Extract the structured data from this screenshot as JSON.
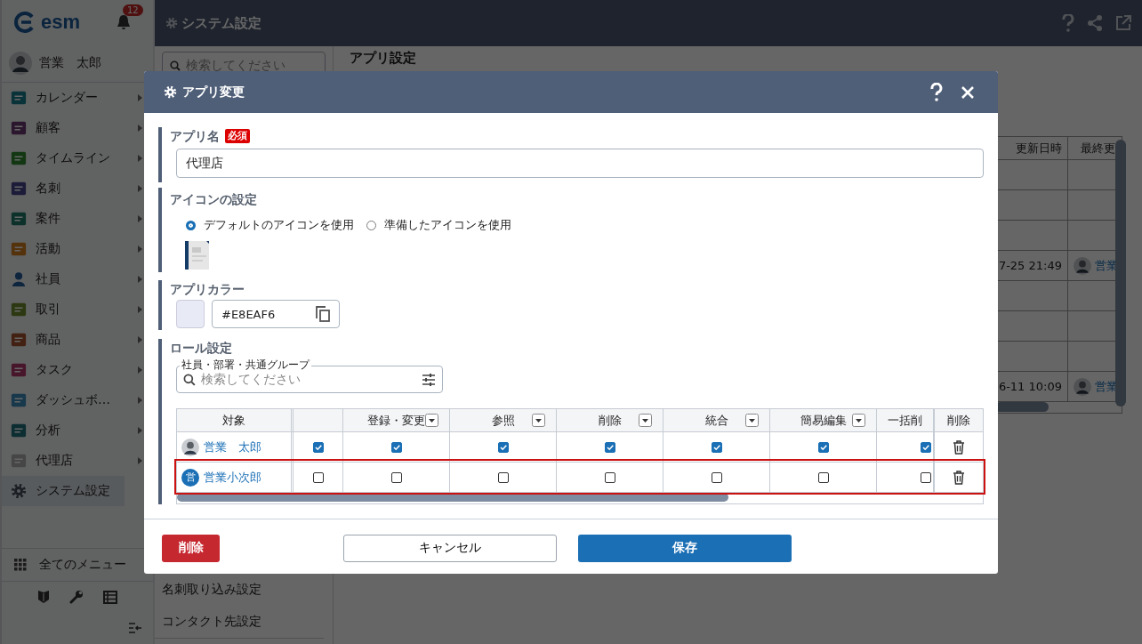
{
  "sidebar": {
    "logo": "esm",
    "notifications": "12",
    "user": "営業　太郎",
    "items": [
      {
        "label": "カレンダー",
        "selected": false,
        "submenu": true
      },
      {
        "label": "顧客",
        "selected": false,
        "submenu": true
      },
      {
        "label": "タイムライン",
        "selected": false,
        "submenu": true
      },
      {
        "label": "名刺",
        "selected": false,
        "submenu": true
      },
      {
        "label": "案件",
        "selected": false,
        "submenu": true
      },
      {
        "label": "活動",
        "selected": false,
        "submenu": true
      },
      {
        "label": "社員",
        "selected": false,
        "submenu": true
      },
      {
        "label": "取引",
        "selected": false,
        "submenu": true
      },
      {
        "label": "商品",
        "selected": false,
        "submenu": true
      },
      {
        "label": "タスク",
        "selected": false,
        "submenu": true
      },
      {
        "label": "ダッシュボ…",
        "selected": false,
        "submenu": true
      },
      {
        "label": "分析",
        "selected": false,
        "submenu": true
      },
      {
        "label": "代理店",
        "selected": false,
        "submenu": true
      },
      {
        "label": "システム設定",
        "selected": true,
        "submenu": false
      }
    ],
    "all_menu": "全てのメニュー"
  },
  "header": {
    "title": "システム設定"
  },
  "settings_panel": {
    "search_placeholder": "検索してください",
    "items": [
      "名刺取り込み設定",
      "コンタクト先設定"
    ]
  },
  "page": {
    "title": "アプリ設定",
    "table": {
      "columns": [
        "更新日時",
        "最終更"
      ],
      "rows": [
        {
          "updated": "",
          "updater": ""
        },
        {
          "updated": "",
          "updater": ""
        },
        {
          "updated": "",
          "updater": ""
        },
        {
          "updated": "7-25 21:49",
          "updater": "営業"
        },
        {
          "updated": "",
          "updater": ""
        },
        {
          "updated": "",
          "updater": ""
        },
        {
          "updated": "",
          "updater": ""
        },
        {
          "updated": "6-11 10:09",
          "updater": "営業"
        }
      ]
    }
  },
  "dialog": {
    "title": "アプリ変更",
    "app_name": {
      "label": "アプリ名",
      "required": "必須",
      "value": "代理店"
    },
    "icon_setting": {
      "label": "アイコンの設定",
      "options": [
        {
          "label": "デフォルトのアイコンを使用",
          "selected": true
        },
        {
          "label": "準備したアイコンを使用",
          "selected": false
        }
      ]
    },
    "app_color": {
      "label": "アプリカラー",
      "value": "#E8EAF6"
    },
    "roles": {
      "label": "ロール設定",
      "search": {
        "label": "社員・部署・共通グループ",
        "placeholder": "検索してください"
      },
      "target_header": "対象",
      "delete_header": "削除",
      "columns": [
        {
          "label": "登録・変更",
          "menu": true
        },
        {
          "label": "参照",
          "menu": true
        },
        {
          "label": "削除",
          "menu": true
        },
        {
          "label": "統合",
          "menu": true
        },
        {
          "label": "簡易編集",
          "menu": true
        },
        {
          "label": "一括削",
          "menu": false
        }
      ],
      "rows": [
        {
          "name": "営業　太郎",
          "avatar": {
            "kind": "photo"
          },
          "checks": [
            true,
            true,
            true,
            true,
            true,
            true,
            true
          ],
          "highlighted": false
        },
        {
          "name": "営業小次郎",
          "avatar": {
            "kind": "initial",
            "initial": "営"
          },
          "checks": [
            false,
            false,
            false,
            false,
            false,
            false,
            false
          ],
          "highlighted": true
        }
      ]
    },
    "buttons": {
      "delete": "削除",
      "cancel": "キャンセル",
      "save": "保存"
    }
  }
}
